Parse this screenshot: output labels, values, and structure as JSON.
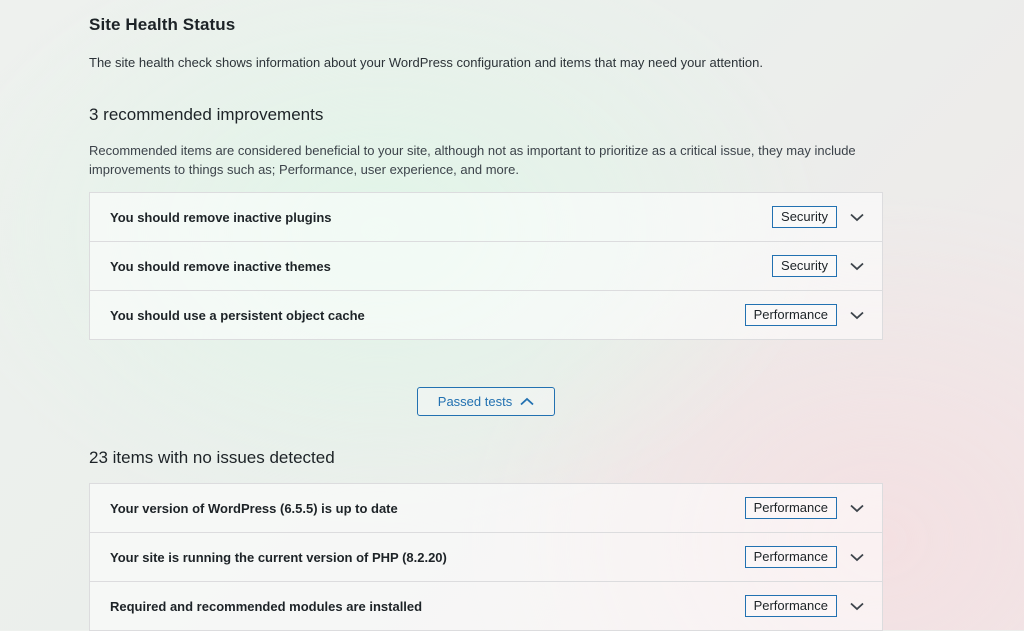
{
  "page": {
    "title": "Site Health Status",
    "description": "The site health check shows information about your WordPress configuration and items that may need your attention."
  },
  "recommended": {
    "heading": "3 recommended improvements",
    "description": "Recommended items are considered beneficial to your site, although not as important to prioritize as a critical issue, they may include improvements to things such as; Performance, user experience, and more.",
    "items": [
      {
        "label": "You should remove inactive plugins",
        "badge": "Security",
        "icon": "chevron-down-icon"
      },
      {
        "label": "You should remove inactive themes",
        "badge": "Security",
        "icon": "chevron-down-icon"
      },
      {
        "label": "You should use a persistent object cache",
        "badge": "Performance",
        "icon": "chevron-down-icon"
      }
    ]
  },
  "passed_button": {
    "label": "Passed tests",
    "icon": "chevron-up-icon"
  },
  "passed": {
    "heading": "23 items with no issues detected",
    "items": [
      {
        "label": "Your version of WordPress (6.5.5) is up to date",
        "badge": "Performance",
        "icon": "chevron-down-icon"
      },
      {
        "label": "Your site is running the current version of PHP (8.2.20)",
        "badge": "Performance",
        "icon": "chevron-down-icon"
      },
      {
        "label": "Required and recommended modules are installed",
        "badge": "Performance",
        "icon": "chevron-down-icon"
      }
    ]
  },
  "colors": {
    "accent": "#2271b1",
    "text": "#1d2327",
    "border": "#dcdcde"
  }
}
